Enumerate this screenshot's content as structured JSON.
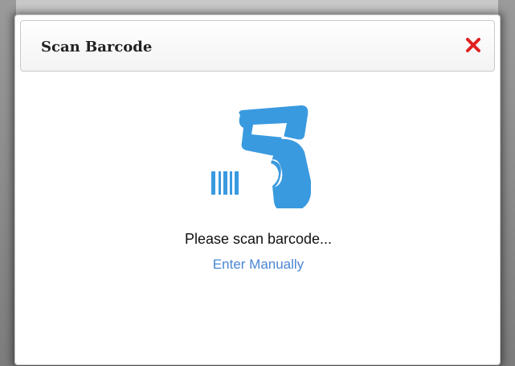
{
  "dialog": {
    "title": "Scan Barcode",
    "close_icon": "close-icon",
    "scanner_icon": "barcode-scanner-icon",
    "status_text": "Please scan barcode...",
    "manual_link": "Enter Manually"
  },
  "colors": {
    "accent": "#3a9ae0",
    "close": "#e02020",
    "link": "#4a86d4"
  }
}
